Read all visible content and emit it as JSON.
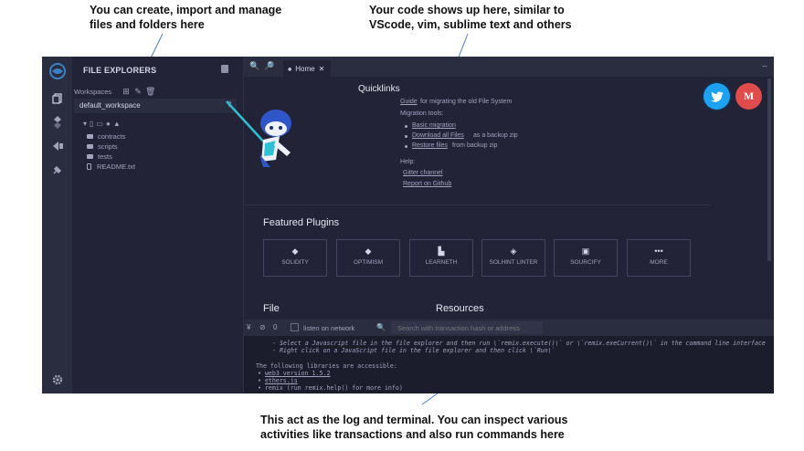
{
  "annotations": {
    "left_line1": "You can create, import and manage",
    "left_line2": "files and folders here",
    "right_line1": "Your code shows up here, similar to",
    "right_line2": "VScode, vim, sublime text and others",
    "bottom_line1": "This act as the log and terminal. You can inspect various",
    "bottom_line2": "activities like transactions and also run commands here"
  },
  "side_panel": {
    "title": "FILE EXPLORERS",
    "workspaces_label": "Workspaces",
    "workspace_selected": "default_workspace",
    "tree": [
      "contracts",
      "scripts",
      "tests",
      "README.txt"
    ]
  },
  "tabs": {
    "home_label": "Home"
  },
  "home": {
    "quicklinks_title": "Quicklinks",
    "guide_link": "Guide",
    "guide_text": "for migrating the old File System",
    "migration_tools": "Migration tools:",
    "basic_migration": "Basic migration",
    "download_all_files": "Download all Files",
    "download_suffix": "as a backup zip",
    "restore_files": "Restore files",
    "restore_suffix": "from backup zip",
    "help_label": "Help:",
    "gitter": "Gitter channel",
    "report_github": "Report on Github",
    "featured_title": "Featured Plugins",
    "plugins": [
      "SOLIDITY",
      "OPTIMISM",
      "LEARNETH",
      "SOLHINT LINTER",
      "SOURCIFY",
      "MORE"
    ],
    "file_title": "File",
    "resources_title": "Resources",
    "medium_letter": "M"
  },
  "terminal": {
    "count": "0",
    "listen_label": "listen on network",
    "search_placeholder": "Search with transaction hash or address",
    "line1": "- Select a Javascript file in the file explorer and then run \\`remix.execute()\\` or \\`remix.exeCurrent()\\`  in the command line interface",
    "line2": "- Right click on a JavaScript file in the file explorer and then click \\`Run\\`",
    "line3": "The following libraries are accessible:",
    "lib1": "web3 version 1.5.2",
    "lib2": "ethers.js",
    "lib3": "remix (run remix.help() for more info)"
  },
  "icons": {
    "remix_logo": "remix-logo-icon",
    "file_explorer": "files-icon",
    "compiler": "solidity-compiler-icon",
    "deploy": "deploy-run-icon",
    "plugin_manager": "plugin-icon",
    "settings": "gear-icon"
  },
  "colors": {
    "app_bg": "#222336",
    "panel_bg": "#2a2c3f",
    "terminal_bg": "#1b1c2c",
    "twitter": "#1da1f2",
    "medium": "#e04b4b",
    "annotation_line": "#4a7fc4"
  }
}
